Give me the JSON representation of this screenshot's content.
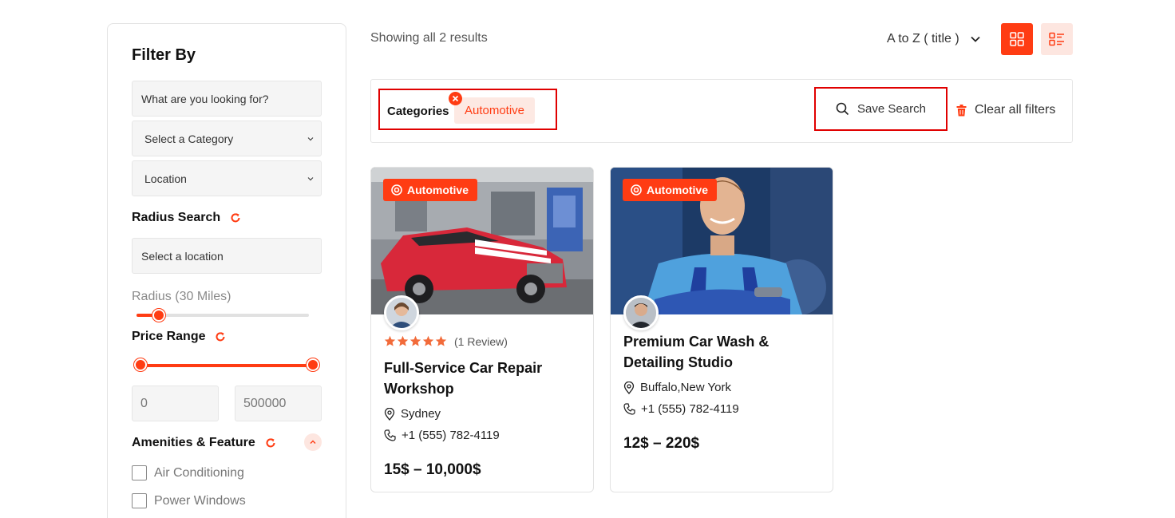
{
  "sidebar": {
    "title": "Filter By",
    "search_placeholder": "What are you looking for?",
    "category_select": "Select a Category",
    "location_select": "Location",
    "radius_search": {
      "title": "Radius Search",
      "location_placeholder": "Select a location",
      "radius_label": "Radius (30 Miles)",
      "radius_fraction": 0.13
    },
    "price_range": {
      "title": "Price Range",
      "min": "0",
      "max": "500000"
    },
    "amenities": {
      "title": "Amenities & Feature",
      "items": [
        {
          "label": "Air Conditioning",
          "checked": false
        },
        {
          "label": "Power Windows",
          "checked": false
        }
      ]
    }
  },
  "results": {
    "count_text": "Showing all 2 results",
    "sort_label": "A to Z ( title )"
  },
  "filter_bar": {
    "categories_label": "Categories",
    "active_chip": "Automotive",
    "save_search": "Save Search",
    "clear_all": "Clear all filters"
  },
  "cards": [
    {
      "badge": "Automotive",
      "rating": 5,
      "review_text": "(1 Review)",
      "title": "Full-Service Car Repair Workshop",
      "location": "Sydney",
      "phone": "+1 (555) 782-4119",
      "price": "15$ – 10,000$"
    },
    {
      "badge": "Automotive",
      "title": "Premium Car Wash & Detailing Studio",
      "location": "Buffalo,New York",
      "phone": "+1 (555) 782-4119",
      "price": "12$ – 220$"
    }
  ],
  "colors": {
    "accent": "#ff3c13",
    "accent_light": "#fde6e0",
    "highlight_border": "#e00000"
  }
}
